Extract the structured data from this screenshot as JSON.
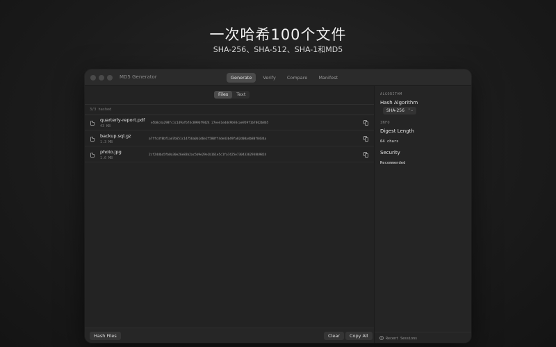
{
  "hero": {
    "title": "一次哈希100个文件",
    "subtitle": "SHA-256、SHA-512、SHA-1和MD5"
  },
  "window": {
    "title": "MD5 Generator",
    "modes": [
      "Generate",
      "Verify",
      "Compare",
      "Manifest"
    ],
    "active_mode": "Generate"
  },
  "input_toggle": {
    "options": [
      "Files",
      "Text"
    ],
    "active": "Files"
  },
  "status": {
    "hashed_count": "3/3 hashed"
  },
  "files": [
    {
      "name": "quarterly-report.pdf",
      "size": "43 KB",
      "hash": "e5b8c4a298fc1c149afbf4c899bf9424 27ee41edd49b93cae959f1b7862b865",
      "icon": "file-icon"
    },
    {
      "name": "backup.sql.gz",
      "size": "1.3 MB",
      "hash": "a7ffcdf8bf1ad7b651c14756a0b1d6e2f580ff4de43b49fa82d08a4b80f8434a",
      "icon": "file-icon"
    },
    {
      "name": "photo.jpg",
      "size": "1.6 MB",
      "hash": "2cf24dba5fb0a30e26e83b2ac5b9e29e1b161e5c1fa7425e73043362938b9824",
      "icon": "file-icon"
    }
  ],
  "footer": {
    "hash_button": "Hash Files",
    "clear_button": "Clear",
    "copy_all_button": "Copy All"
  },
  "sidebar": {
    "algorithm_section": "ALGORITHM",
    "algorithm_label": "Hash Algorithm",
    "algorithm_value": "SHA-256",
    "info_section": "INFO",
    "digest_label": "Digest Length",
    "digest_value": "64 chars",
    "security_label": "Security",
    "security_value": "Recommended",
    "recent_sessions": "Recent Sessions"
  },
  "colors": {
    "background": "#1b1b1b",
    "window": "#232323",
    "active_mode": "#4a4a4a"
  }
}
